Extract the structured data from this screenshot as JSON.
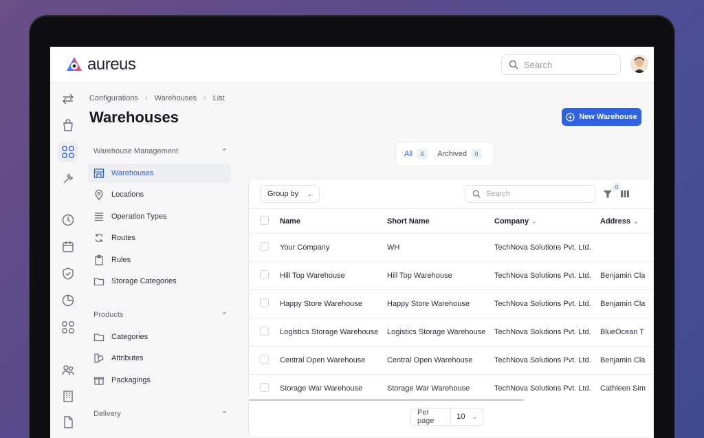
{
  "app": {
    "name": "aureus"
  },
  "top_search": {
    "placeholder": "Search"
  },
  "breadcrumb": [
    "Configurations",
    "Warehouses",
    "List"
  ],
  "page_title": "Warehouses",
  "new_button": "New Warehouse",
  "sidebar": {
    "sections": [
      {
        "title": "Warehouse Management",
        "items": [
          "Warehouses",
          "Locations",
          "Operation Types",
          "Routes",
          "Rules",
          "Storage Categories"
        ]
      },
      {
        "title": "Products",
        "items": [
          "Categories",
          "Attributes",
          "Packagings"
        ]
      },
      {
        "title": "Delivery",
        "items": []
      }
    ],
    "active_item": "Warehouses"
  },
  "tabs": [
    {
      "label": "All",
      "count": "6"
    },
    {
      "label": "Archived",
      "count": "0"
    }
  ],
  "toolbar": {
    "group_by": "Group by",
    "search_placeholder": "Search",
    "filter_count": "0"
  },
  "table": {
    "columns": [
      "Name",
      "Short Name",
      "Company",
      "Address"
    ],
    "rows": [
      [
        "Your Company",
        "WH",
        "TechNova Solutions Pvt. Ltd.",
        ""
      ],
      [
        "Hill Top Warehouse",
        "Hill Top Warehouse",
        "TechNova Solutions Pvt. Ltd.",
        "Benjamin Cla"
      ],
      [
        "Happy Store Warehouse",
        "Happy Store Warehouse",
        "TechNova Solutions Pvt. Ltd.",
        "Benjamin Cla"
      ],
      [
        "Logistics Storage Warehouse",
        "Logistics Storage Warehouse",
        "TechNova Solutions Pvt. Ltd.",
        "BlueOcean T"
      ],
      [
        "Central Open Warehouse",
        "Central Open Warehouse",
        "TechNova Solutions Pvt. Ltd.",
        "Benjamin Cla"
      ],
      [
        "Storage War Warehouse",
        "Storage War Warehouse",
        "TechNova Solutions Pvt. Ltd.",
        "Cathleen Sim"
      ]
    ]
  },
  "pagination": {
    "label": "Per page",
    "value": "10"
  },
  "colors": {
    "accent": "#2f62e0",
    "active_text": "#2d5fd4"
  }
}
